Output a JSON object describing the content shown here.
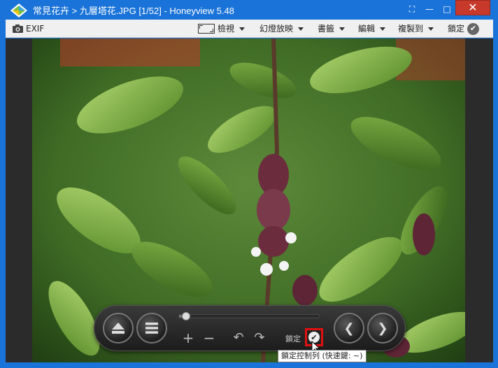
{
  "titlebar": {
    "title": "常見花卉 > 九層塔花.JPG [1/52] - Honeyview 5.48",
    "minimize": "—",
    "maximize": "□",
    "close": "✕",
    "fullscreen": "⛶"
  },
  "toolbar": {
    "exif": "EXIF",
    "view": "檢視",
    "slideshow": "幻燈放映",
    "bookmark": "書籤",
    "edit": "編輯",
    "copy_to": "複製到",
    "lock": "鎖定"
  },
  "controls": {
    "seek_progress": 0.02,
    "zoom_in": "+",
    "zoom_out": "−",
    "rotate_left": "↶",
    "rotate_right": "↷",
    "lock_label": "鎖定",
    "prev": "❮",
    "next": "❯"
  },
  "tooltip": {
    "text": "鎖定控制列 (快速鍵: ~)"
  },
  "colors": {
    "frame": "#1a73d8",
    "close": "#c7392a",
    "highlight": "#e01010"
  }
}
